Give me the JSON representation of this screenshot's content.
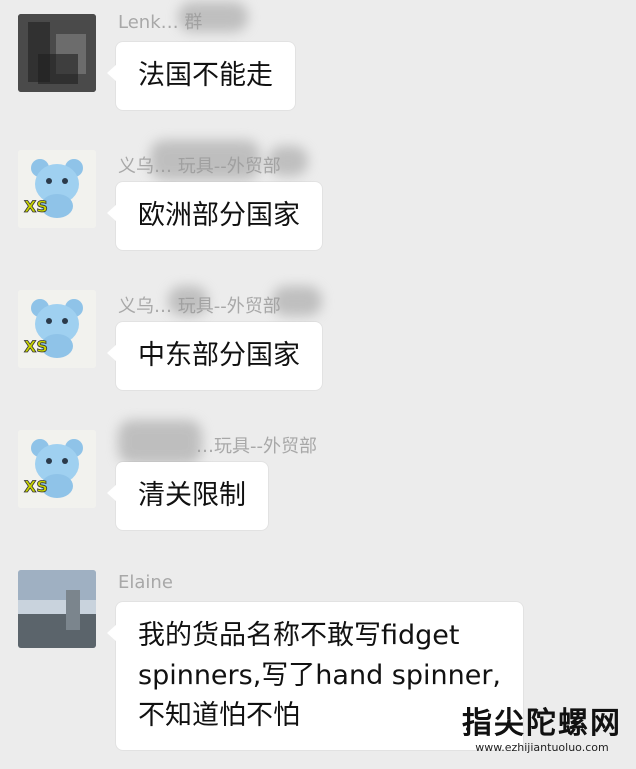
{
  "colors": {
    "background": "#ececec",
    "bubble": "#ffffff",
    "sender_text": "#a8a8a8",
    "message_text": "#111111"
  },
  "messages": [
    {
      "sender": "Lenk…  群",
      "avatar_icon": "blurred-photo-avatar-icon",
      "lines": [
        "法国不能走"
      ]
    },
    {
      "sender": "义乌…  玩具--外贸部",
      "avatar_icon": "blue-mascot-avatar-icon",
      "lines": [
        "欧洲部分国家"
      ]
    },
    {
      "sender": "义乌… 玩具--外贸部",
      "avatar_icon": "blue-mascot-avatar-icon",
      "lines": [
        "中东部分国家"
      ]
    },
    {
      "sender": "…玩具--外贸部",
      "avatar_icon": "blue-mascot-avatar-icon",
      "lines": [
        "清关限制"
      ]
    },
    {
      "sender": "Elaine",
      "avatar_icon": "sky-photo-avatar-icon",
      "lines": [
        "我的货品名称不敢写fidget",
        "spinners,写了hand spinner,",
        "不知道怕不怕"
      ]
    }
  ],
  "watermark": {
    "title": "指尖陀螺网",
    "url": "www.ezhijiantuoluo.com"
  }
}
